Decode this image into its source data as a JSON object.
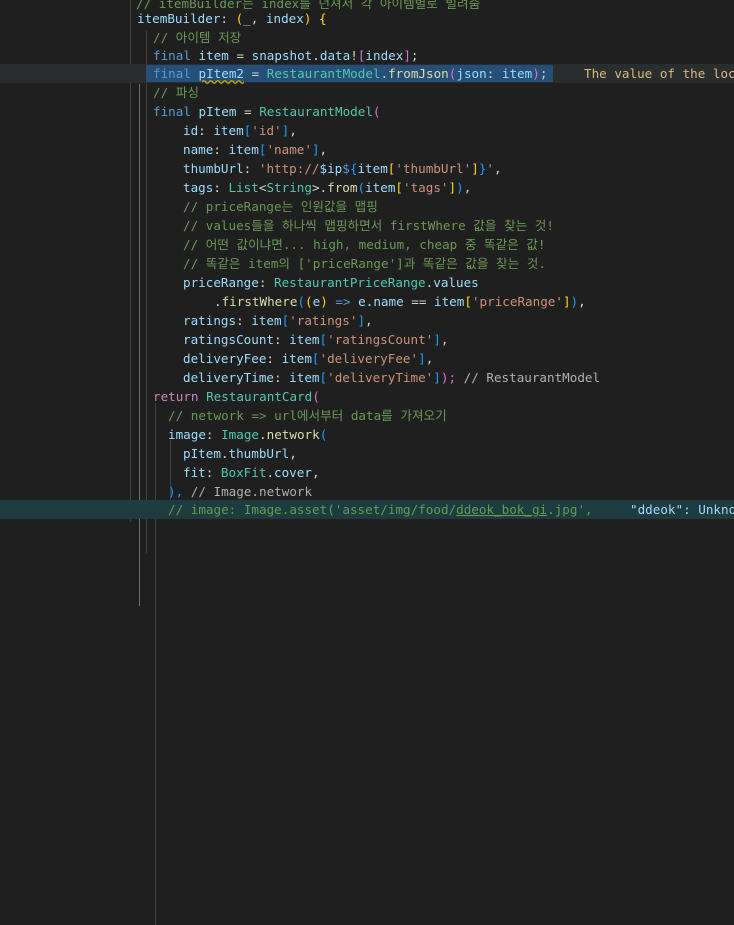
{
  "lines": [
    {
      "text": "// itemBuilder는 index를 던져서 각 아이템별로 빌려줌",
      "type": "comment_top"
    },
    {
      "tokens": [
        [
          "itemBuilder",
          "var"
        ],
        [
          ": ",
          "punc"
        ],
        [
          "(",
          "brk1"
        ],
        [
          "_",
          "var"
        ],
        [
          ", ",
          "punc"
        ],
        [
          "index",
          "var"
        ],
        [
          ")",
          "brk1"
        ],
        [
          " {",
          "brk1"
        ]
      ]
    },
    {
      "tokens": [
        [
          "// 아이템 저장",
          "cmt"
        ]
      ]
    },
    {
      "tokens": [
        [
          "final",
          "kw"
        ],
        [
          " ",
          "punc"
        ],
        [
          "item",
          "var"
        ],
        [
          " = ",
          "punc"
        ],
        [
          "snapshot",
          "var"
        ],
        [
          ".",
          "punc"
        ],
        [
          "data",
          "var"
        ],
        [
          "!",
          "punc"
        ],
        [
          "[",
          "brk2"
        ],
        [
          "index",
          "var"
        ],
        [
          "]",
          "brk2"
        ],
        [
          ";",
          "punc"
        ]
      ]
    },
    {
      "tokens": [
        [
          "final",
          "kw"
        ],
        [
          " ",
          "punc"
        ],
        [
          "pItem2",
          "var"
        ],
        [
          " = ",
          "punc"
        ],
        [
          "RestaurantModel",
          "cls"
        ],
        [
          ".",
          "punc"
        ],
        [
          "fromJson",
          "fn"
        ],
        [
          "(",
          "brk2"
        ],
        [
          "json",
          "var"
        ],
        [
          ": ",
          "punc"
        ],
        [
          "item",
          "var"
        ],
        [
          ")",
          "brk2"
        ],
        [
          ";",
          "punc"
        ]
      ],
      "inline": "The value of the loc"
    },
    {
      "tokens": [
        [
          "// 파싱",
          "cmt"
        ]
      ]
    },
    {
      "tokens": [
        [
          "final",
          "kw"
        ],
        [
          " ",
          "punc"
        ],
        [
          "pItem",
          "var"
        ],
        [
          " = ",
          "punc"
        ],
        [
          "RestaurantModel",
          "cls"
        ],
        [
          "(",
          "brk2"
        ]
      ]
    },
    {
      "tokens": [
        [
          "id",
          "var"
        ],
        [
          ": ",
          "punc"
        ],
        [
          "item",
          "var"
        ],
        [
          "[",
          "brk3"
        ],
        [
          "'id'",
          "str"
        ],
        [
          "]",
          "brk3"
        ],
        [
          ",",
          "punc"
        ]
      ]
    },
    {
      "tokens": [
        [
          "name",
          "var"
        ],
        [
          ": ",
          "punc"
        ],
        [
          "item",
          "var"
        ],
        [
          "[",
          "brk3"
        ],
        [
          "'name'",
          "str"
        ],
        [
          "]",
          "brk3"
        ],
        [
          ",",
          "punc"
        ]
      ]
    },
    {
      "tokens": [
        [
          "thumbUrl",
          "var"
        ],
        [
          ": ",
          "punc"
        ],
        [
          "'",
          "str"
        ],
        [
          "http://",
          "str"
        ],
        [
          "$ip",
          "var"
        ],
        [
          "$",
          "kw"
        ],
        [
          "{",
          "brk3"
        ],
        [
          "item",
          "var"
        ],
        [
          "[",
          "brk1"
        ],
        [
          "'thumbUrl'",
          "str"
        ],
        [
          "]",
          "brk1"
        ],
        [
          "}",
          "brk3"
        ],
        [
          "'",
          "str"
        ],
        [
          ",",
          "punc"
        ]
      ]
    },
    {
      "tokens": [
        [
          "tags",
          "var"
        ],
        [
          ": ",
          "punc"
        ],
        [
          "List",
          "cls"
        ],
        [
          "<",
          "punc"
        ],
        [
          "String",
          "cls"
        ],
        [
          ">",
          "punc"
        ],
        [
          ".",
          "punc"
        ],
        [
          "from",
          "fn"
        ],
        [
          "(",
          "brk3"
        ],
        [
          "item",
          "var"
        ],
        [
          "[",
          "brk1"
        ],
        [
          "'tags'",
          "str"
        ],
        [
          "]",
          "brk1"
        ],
        [
          ")",
          "brk3"
        ],
        [
          ",",
          "punc"
        ]
      ]
    },
    {
      "tokens": [
        [
          "// priceRange는 인원값을 맵핑",
          "cmt"
        ]
      ]
    },
    {
      "tokens": [
        [
          "// values들을 하나씩 맵핑하면서 firstWhere 값을 찾는 것!",
          "cmt"
        ]
      ]
    },
    {
      "tokens": [
        [
          "// 어떤 값이냐면... high, medium, cheap 중 똑같은 값!",
          "cmt"
        ]
      ]
    },
    {
      "tokens": [
        [
          "// 똑같은 item의 ['priceRange']과 똑같은 값을 찾는 것.",
          "cmt"
        ]
      ]
    },
    {
      "tokens": [
        [
          "priceRange",
          "var"
        ],
        [
          ": ",
          "punc"
        ],
        [
          "RestaurantPriceRange",
          "cls"
        ],
        [
          ".",
          "punc"
        ],
        [
          "values",
          "var"
        ]
      ]
    },
    {
      "tokens": [
        [
          ".",
          "punc"
        ],
        [
          "firstWhere",
          "fn"
        ],
        [
          "(",
          "brk3"
        ],
        [
          "(",
          "brk1"
        ],
        [
          "e",
          "var"
        ],
        [
          ")",
          "brk1"
        ],
        [
          " => ",
          "kw"
        ],
        [
          "e",
          "var"
        ],
        [
          ".",
          "punc"
        ],
        [
          "name",
          "var"
        ],
        [
          " == ",
          "punc"
        ],
        [
          "item",
          "var"
        ],
        [
          "[",
          "brk1"
        ],
        [
          "'priceRange'",
          "str"
        ],
        [
          "]",
          "brk1"
        ],
        [
          ")",
          "brk3"
        ],
        [
          ",",
          "punc"
        ]
      ]
    },
    {
      "tokens": [
        [
          "ratings",
          "var"
        ],
        [
          ": ",
          "punc"
        ],
        [
          "item",
          "var"
        ],
        [
          "[",
          "brk3"
        ],
        [
          "'ratings'",
          "str"
        ],
        [
          "]",
          "brk3"
        ],
        [
          ",",
          "punc"
        ]
      ]
    },
    {
      "tokens": [
        [
          "ratingsCount",
          "var"
        ],
        [
          ": ",
          "punc"
        ],
        [
          "item",
          "var"
        ],
        [
          "[",
          "brk3"
        ],
        [
          "'ratingsCount'",
          "str"
        ],
        [
          "]",
          "brk3"
        ],
        [
          ",",
          "punc"
        ]
      ]
    },
    {
      "tokens": [
        [
          "deliveryFee",
          "var"
        ],
        [
          ": ",
          "punc"
        ],
        [
          "item",
          "var"
        ],
        [
          "[",
          "brk3"
        ],
        [
          "'deliveryFee'",
          "str"
        ],
        [
          "]",
          "brk3"
        ],
        [
          ",",
          "punc"
        ]
      ]
    },
    {
      "tokens": [
        [
          "deliveryTime",
          "var"
        ],
        [
          ": ",
          "punc"
        ],
        [
          "item",
          "var"
        ],
        [
          "[",
          "brk3"
        ],
        [
          "'deliveryTime'",
          "str"
        ],
        [
          "]",
          "brk3"
        ],
        [
          ");",
          "brk2"
        ],
        [
          " // RestaurantModel",
          "hint"
        ]
      ]
    },
    {
      "tokens": [
        [
          "return",
          "kw2"
        ],
        [
          " ",
          "punc"
        ],
        [
          "RestaurantCard",
          "cls"
        ],
        [
          "(",
          "brk2"
        ]
      ]
    },
    {
      "tokens": [
        [
          "// network => url에서부터 data를 가져오기",
          "cmt"
        ]
      ]
    },
    {
      "tokens": [
        [
          "image",
          "var"
        ],
        [
          ": ",
          "punc"
        ],
        [
          "Image",
          "cls"
        ],
        [
          ".",
          "punc"
        ],
        [
          "network",
          "fn"
        ],
        [
          "(",
          "brk3"
        ]
      ]
    },
    {
      "tokens": [
        [
          "pItem",
          "var"
        ],
        [
          ".",
          "punc"
        ],
        [
          "thumbUrl",
          "var"
        ],
        [
          ",",
          "punc"
        ]
      ]
    },
    {
      "tokens": [
        [
          "fit",
          "var"
        ],
        [
          ": ",
          "punc"
        ],
        [
          "BoxFit",
          "cls"
        ],
        [
          ".",
          "punc"
        ],
        [
          "cover",
          "var"
        ],
        [
          ",",
          "punc"
        ]
      ]
    },
    {
      "tokens": [
        [
          "),",
          "brk3"
        ],
        [
          " // Image.network",
          "hint"
        ]
      ]
    },
    {
      "tokens": [
        [
          "// image: Image.asset('asset/img/food/",
          "cmt"
        ],
        [
          "ddeok_bok_gi",
          "cmt"
        ],
        [
          ".jpg',",
          "cmt"
        ]
      ],
      "inline": "\"ddeok\": Unkno"
    }
  ]
}
